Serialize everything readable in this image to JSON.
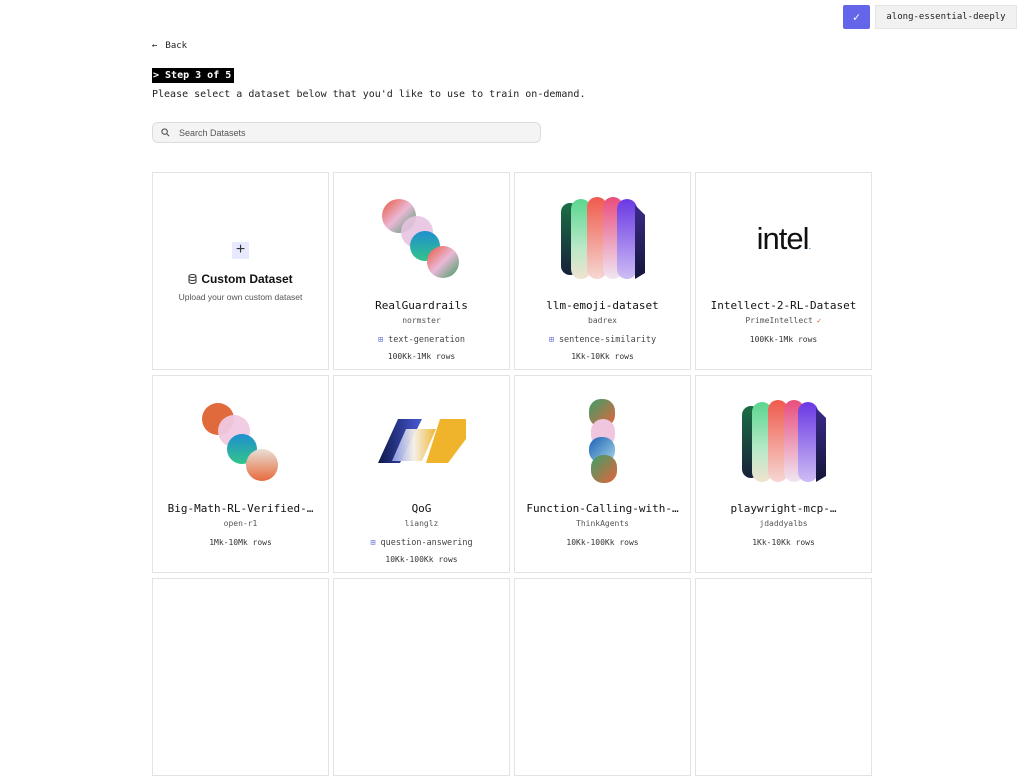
{
  "header": {
    "check_icon": "check-icon",
    "project_name": "along-essential-deeply",
    "back_label": "Back"
  },
  "step": {
    "label": "> Step 3 of 5",
    "instruction": "Please select a dataset below that you'd like to use to train on-demand."
  },
  "search": {
    "placeholder": "Search Datasets"
  },
  "custom_card": {
    "title": "Custom Dataset",
    "subtitle": "Upload your own custom dataset"
  },
  "datasets": [
    {
      "title": "RealGuardrails",
      "author": "normster",
      "tag": "text-generation",
      "rows": "100Kk-1Mk rows",
      "logo": "swirl-logo"
    },
    {
      "title": "llm-emoji-dataset",
      "author": "badrex",
      "tag": "sentence-similarity",
      "rows": "1Kk-10Kk rows",
      "logo": "pillars-logo"
    },
    {
      "title": "Intellect-2-RL-Dataset",
      "author": "PrimeIntellect",
      "tag": "",
      "rows": "100Kk-1Mk rows",
      "logo": "intel-logo",
      "brand": "intel",
      "verified": true
    },
    {
      "title": "Big-Math-RL-Verified-…",
      "author": "open-r1",
      "tag": "",
      "rows": "1Mk-10Mk rows",
      "logo": "swirl-logo"
    },
    {
      "title": "QoG",
      "author": "lianglz",
      "tag": "question-answering",
      "rows": "10Kk-100Kk rows",
      "logo": "parallelogram-logo"
    },
    {
      "title": "Function-Calling-with-…",
      "author": "ThinkAgents",
      "tag": "",
      "rows": "10Kk-100Kk rows",
      "logo": "stack-logo"
    },
    {
      "title": "playwright-mcp-…",
      "author": "jdaddyalbs",
      "tag": "",
      "rows": "1Kk-10Kk rows",
      "logo": "pillars-logo"
    }
  ],
  "colors": {
    "accent": "#6466e9",
    "verified": "#e05a4a",
    "tag_icon": "#6c7bd9"
  }
}
